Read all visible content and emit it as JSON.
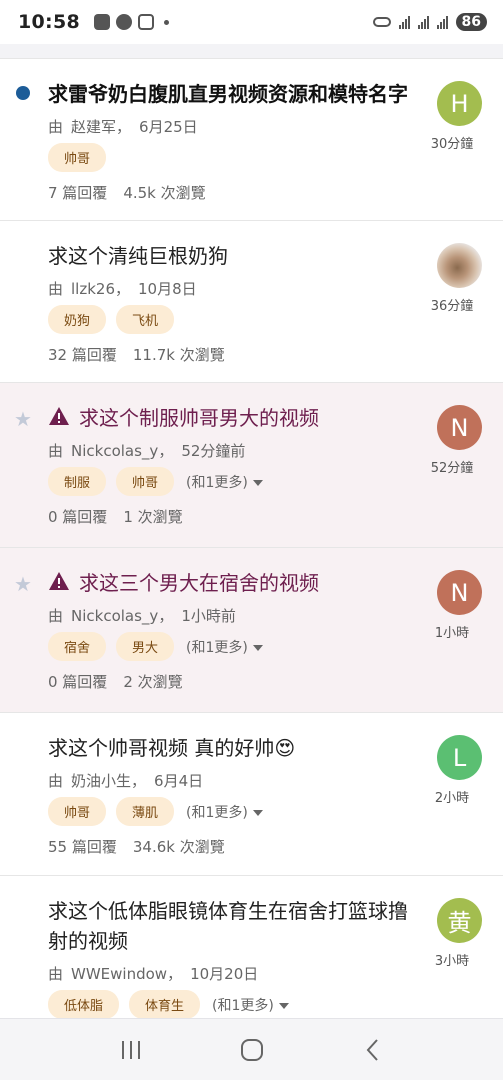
{
  "status_bar": {
    "time": "10:58",
    "battery": "86",
    "icons": [
      "check-badge-icon",
      "wechat-icon",
      "screenshot-icon",
      "dot-icon",
      "key-icon",
      "signal-5g-icon",
      "signal-5g-icon",
      "wifi-signal-icon"
    ]
  },
  "topics": [
    {
      "title": "求雷爷奶白腹肌直男视频资源和模特名字",
      "style": "unread",
      "meta_prefix": "由",
      "author": "赵建军",
      "date": "6月25日",
      "tags": [
        "帅哥"
      ],
      "more_tags": "",
      "replies": "7 篇回覆",
      "views": "4.5k 次瀏覽",
      "avatar_letter": "H",
      "avatar_color": "#a3bd4f",
      "activity": "30分鐘"
    },
    {
      "title": "求这个清纯巨根奶狗",
      "style": "normal",
      "meta_prefix": "由",
      "author": "llzk26",
      "date": "10月8日",
      "tags": [
        "奶狗",
        "飞机"
      ],
      "more_tags": "",
      "replies": "32 篇回覆",
      "views": "11.7k 次瀏覽",
      "avatar_letter": "",
      "avatar_color": "photo",
      "activity": "36分鐘"
    },
    {
      "title": "求这个制服帅哥男大的视频",
      "style": "pinned",
      "meta_prefix": "由",
      "author": "Nickcolas_y",
      "date": "52分鐘前",
      "tags": [
        "制服",
        "帅哥"
      ],
      "more_tags": "(和1更多)",
      "replies": "0 篇回覆",
      "views": "1 次瀏覽",
      "avatar_letter": "N",
      "avatar_color": "#c0715a",
      "activity": "52分鐘"
    },
    {
      "title": "求这三个男大在宿舍的视频",
      "style": "pinned",
      "meta_prefix": "由",
      "author": "Nickcolas_y",
      "date": "1小時前",
      "tags": [
        "宿舍",
        "男大"
      ],
      "more_tags": "(和1更多)",
      "replies": "0 篇回覆",
      "views": "2 次瀏覽",
      "avatar_letter": "N",
      "avatar_color": "#c0715a",
      "activity": "1小時"
    },
    {
      "title": "求这个帅哥视频 真的好帅😍",
      "style": "normal",
      "meta_prefix": "由",
      "author": "奶油小生",
      "date": "6月4日",
      "tags": [
        "帅哥",
        "薄肌"
      ],
      "more_tags": "(和1更多)",
      "replies": "55 篇回覆",
      "views": "34.6k 次瀏覽",
      "avatar_letter": "L",
      "avatar_color": "#5bbf72",
      "activity": "2小時"
    },
    {
      "title": "求这个低体脂眼镜体育生在宿舍打篮球撸射的视频",
      "style": "normal",
      "meta_prefix": "由",
      "author": "WWEwindow",
      "date": "10月20日",
      "tags": [
        "低体脂",
        "体育生"
      ],
      "more_tags": "(和1更多)",
      "replies": "",
      "views": "",
      "avatar_letter": "黄",
      "avatar_color": "#a3bd4f",
      "activity": "3小時"
    }
  ],
  "nav": [
    "recents-button",
    "home-button",
    "back-button"
  ]
}
